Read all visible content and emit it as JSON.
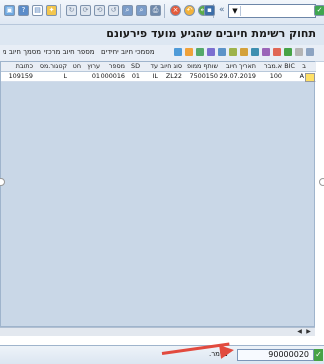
{
  "window": {
    "title": "תחוק רשימת חיובים שהגיע מועד פירעונם"
  },
  "toolbar": {
    "command_field": "",
    "chevron": "«"
  },
  "app_toolbar": {
    "buttons": [
      "מסמך חיוב מרכזי",
      "מספר חיוב מרכזי",
      "מסמכי חיוב יחידים"
    ]
  },
  "table": {
    "columns": [
      "ב",
      "BIC",
      "א.מבר",
      "תאריך חיוב",
      "שותף ממופ",
      "סוג חיוב",
      "עד",
      "SD",
      "מספר",
      "ערוץ",
      "חט",
      "קטגור.מס",
      "כתובת"
    ],
    "rows": [
      {
        "flag": "A",
        "bic": "",
        "member": "100",
        "date": "29.07.2019",
        "partner": "7500150",
        "type": "ZL22",
        "until": "IL",
        "sd": "01",
        "number": "70000016",
        "channel": "01",
        "tax": "",
        "category": "L",
        "address": "109159"
      }
    ]
  },
  "status": {
    "label": "נשמר.",
    "value": "90000020"
  },
  "colors": {
    "accent": "#46a346",
    "arrow": "#e24a3e",
    "table_bg": "#c9d7e7"
  }
}
